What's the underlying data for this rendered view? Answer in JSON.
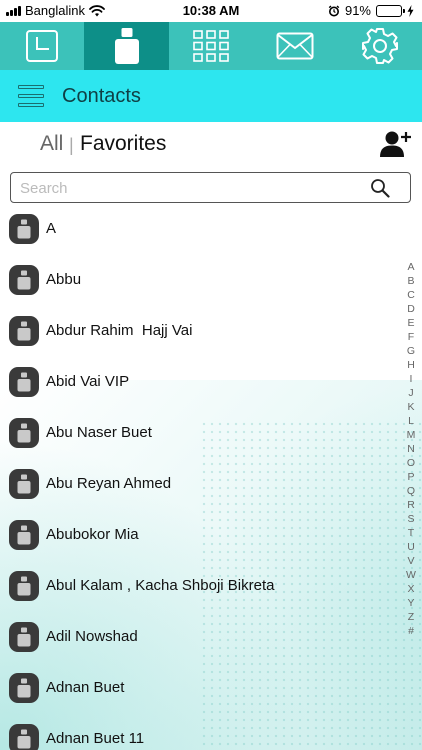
{
  "status_bar": {
    "carrier": "Banglalink",
    "time": "10:38 AM",
    "battery": "91%",
    "battery_level": 0.91
  },
  "tabs": [
    {
      "icon": "clock-icon",
      "active": false
    },
    {
      "icon": "contact-phone-icon",
      "active": true
    },
    {
      "icon": "dialpad-icon",
      "active": false
    },
    {
      "icon": "envelope-icon",
      "active": false
    },
    {
      "icon": "gear-icon",
      "active": false
    }
  ],
  "header": {
    "title": "Contacts"
  },
  "filter": {
    "all_label": "All",
    "separator": "|",
    "favorites_label": "Favorites"
  },
  "search": {
    "placeholder": "Search",
    "value": ""
  },
  "contacts": [
    "A",
    "Abbu",
    "Abdur Rahim  Hajj Vai",
    "Abid Vai VIP",
    "Abu Naser Buet",
    "Abu Reyan Ahmed",
    "Abubokor Mia",
    "Abul Kalam , Kacha Shboji Bikreta",
    "Adil Nowshad",
    "Adnan Buet",
    "Adnan Buet 11"
  ],
  "alphabet": [
    "A",
    "B",
    "C",
    "D",
    "E",
    "F",
    "G",
    "H",
    "I",
    "J",
    "K",
    "L",
    "M",
    "N",
    "O",
    "P",
    "Q",
    "R",
    "S",
    "T",
    "U",
    "V",
    "W",
    "X",
    "Y",
    "Z",
    "#"
  ],
  "colors": {
    "tab_bar": "#3cc2ba",
    "tab_active": "#0d8f88",
    "header": "#2de6ef",
    "avatar": "#3a3a3a"
  }
}
